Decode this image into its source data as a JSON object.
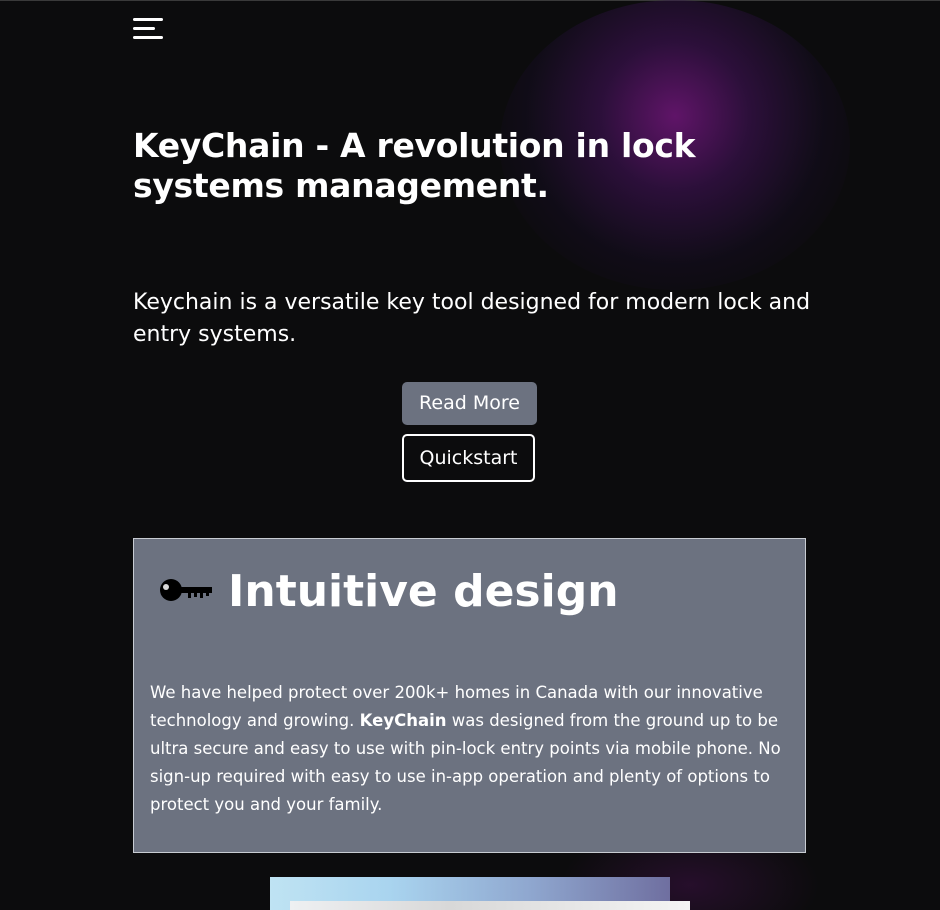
{
  "hero": {
    "title": "KeyChain - A revolution in lock systems management.",
    "description": "Keychain is a versatile key tool designed for modern lock and entry systems."
  },
  "buttons": {
    "read_more": "Read More",
    "quickstart": "Quickstart"
  },
  "feature": {
    "title": "Intuitive design",
    "icon": "key-icon",
    "body_before": "We have helped protect over 200k+ homes in Canada with our innovative technology and growing.  ",
    "body_brand": "KeyChain",
    "body_after": " was designed from the ground up to be ultra secure and easy to use with pin-lock entry points via mobile phone. No sign-up required with easy to use in-app operation and plenty of options to protect you and your family."
  },
  "colors": {
    "background": "#0c0c0d",
    "card": "#6c7280",
    "button_primary": "#6c7280",
    "glow": "#6e1678"
  }
}
